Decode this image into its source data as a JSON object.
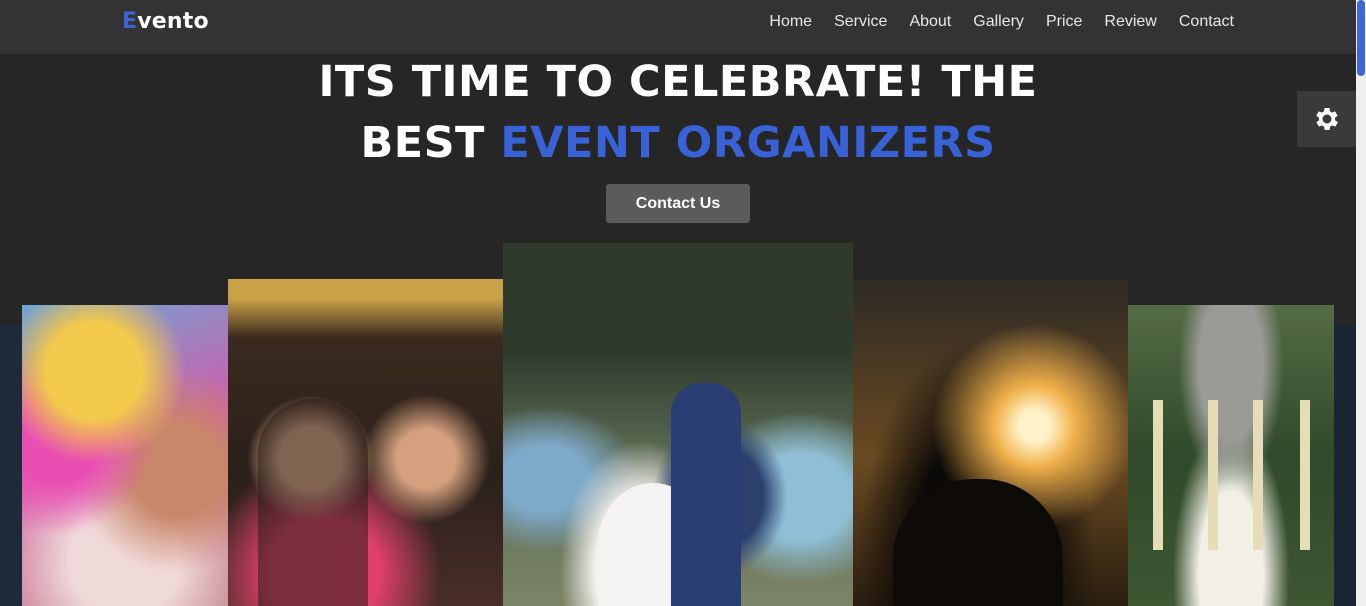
{
  "brand": {
    "first_letter": "E",
    "rest": "vento",
    "accent_color": "#3f63d6"
  },
  "nav": {
    "items": [
      {
        "label": "Home"
      },
      {
        "label": "Service"
      },
      {
        "label": "About"
      },
      {
        "label": "Gallery"
      },
      {
        "label": "Price"
      },
      {
        "label": "Review"
      },
      {
        "label": "Contact"
      }
    ]
  },
  "hero": {
    "line1": "ITS TIME TO CELEBRATE! THE",
    "line2_prefix": "BEST",
    "line2_accent": "EVENT ORGANIZERS",
    "cta_label": "Contact Us"
  },
  "settings": {
    "icon": "gear-icon"
  },
  "gallery": {
    "cards": [
      {
        "subject": "holi-colors-photo"
      },
      {
        "subject": "birthday-party-photo"
      },
      {
        "subject": "wedding-photo"
      },
      {
        "subject": "concert-photo"
      },
      {
        "subject": "gazebo-venue-photo"
      }
    ]
  }
}
